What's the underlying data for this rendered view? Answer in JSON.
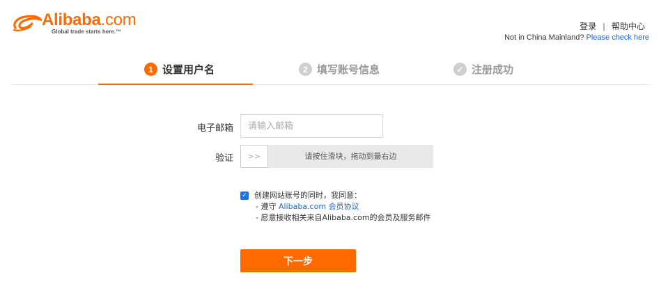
{
  "header": {
    "brand_main": "Alibaba",
    "brand_suffix": ".com",
    "tagline": "Global trade starts here.™",
    "login_link": "登录",
    "separator": "|",
    "help_link": "帮助中心",
    "region_text": "Not in China Mainland? ",
    "region_link": "Please check here"
  },
  "steps": [
    {
      "number": "1",
      "label": "设置用户名",
      "state": "active"
    },
    {
      "number": "2",
      "label": "填写账号信息",
      "state": "inactive"
    },
    {
      "number": "✓",
      "label": "注册成功",
      "state": "inactive"
    }
  ],
  "form": {
    "email_label": "电子邮箱",
    "email_placeholder": "请输入邮箱",
    "email_value": "",
    "verify_label": "验证",
    "slider_handle": ">>",
    "slider_hint": "请按住滑块，拖动到最右边"
  },
  "agreement": {
    "checked": true,
    "intro": "创建网站账号的同时，我同意：",
    "line2_prefix": "- 遵守 ",
    "line2_link": "Alibaba.com 会员协议",
    "line3": "- 愿意接收相关来自Alibaba.com的会员及服务邮件"
  },
  "next_button": "下一步",
  "colors": {
    "accent": "#ff6a00",
    "link": "#1a66cc",
    "checkbox": "#1a73e8"
  }
}
